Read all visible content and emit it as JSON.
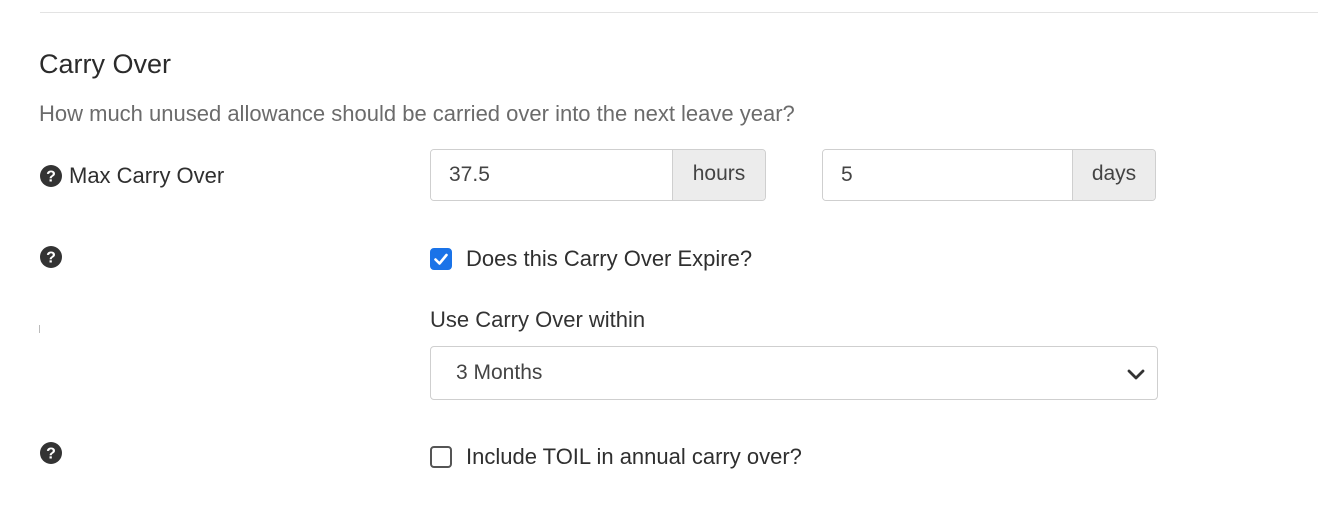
{
  "section": {
    "title": "Carry Over",
    "description": "How much unused allowance should be carried over into the next leave year?"
  },
  "max_carry_over": {
    "label": "Max Carry Over",
    "hours_value": "37.5",
    "hours_unit": "hours",
    "days_value": "5",
    "days_unit": "days"
  },
  "expire": {
    "label": "Does this Carry Over Expire?",
    "checked": true
  },
  "use_within": {
    "label": "Use Carry Over within",
    "selected": "3 Months"
  },
  "toil": {
    "label": "Include TOIL in annual carry over?",
    "checked": false
  },
  "colors": {
    "accent": "#1a73e8",
    "icon": "#333333"
  },
  "icons": {
    "help": "question-circle-icon",
    "dropdown": "chevron-down-icon",
    "check": "checkmark-icon"
  }
}
